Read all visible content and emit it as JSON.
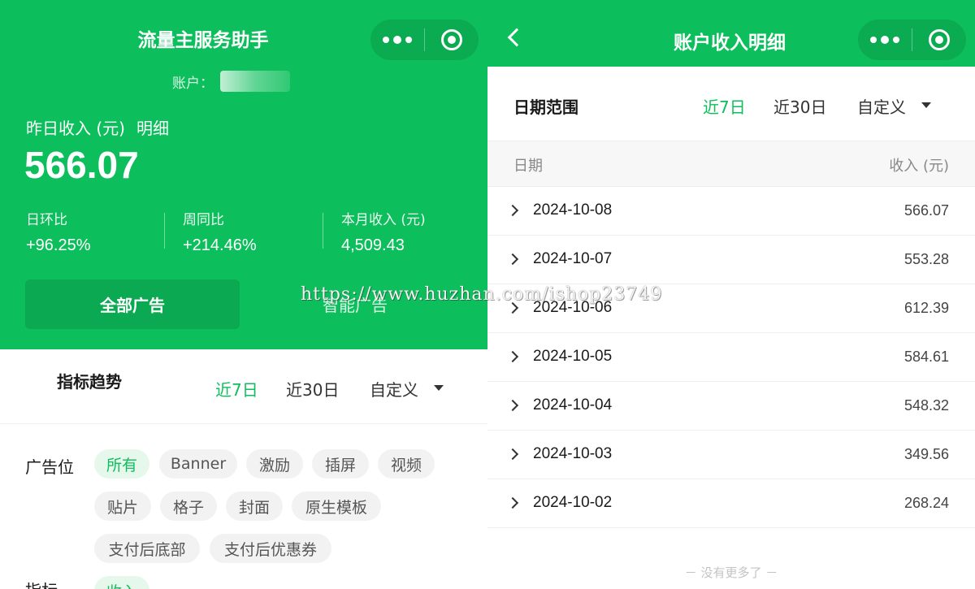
{
  "left": {
    "app_title": "流量主服务助手",
    "account_label": "账户：",
    "yesterday_label": "昨日收入 (元)",
    "detail_link": "明细",
    "yesterday_value": "566.07",
    "stats": [
      {
        "label": "日环比",
        "value": "+96.25%"
      },
      {
        "label": "周同比",
        "value": "+214.46%"
      },
      {
        "label": "本月收入 (元)",
        "value": "4,509.43"
      }
    ],
    "ad_tabs": {
      "all": "全部广告",
      "smart": "智能广告"
    },
    "trend": {
      "title": "指标趋势",
      "ranges": [
        "近7日",
        "近30日",
        "自定义"
      ],
      "active_range": "近7日"
    },
    "ad_position_label": "广告位",
    "ad_positions": [
      "所有",
      "Banner",
      "激励",
      "插屏",
      "视频",
      "贴片",
      "格子",
      "封面",
      "原生模板",
      "支付后底部",
      "支付后优惠券"
    ],
    "active_position": "所有",
    "metric_label": "指标",
    "metric_chip": "收入"
  },
  "right": {
    "title": "账户收入明细",
    "date_range_label": "日期范围",
    "ranges": [
      "近7日",
      "近30日",
      "自定义"
    ],
    "active_range": "近7日",
    "columns": {
      "date": "日期",
      "income": "收入 (元)"
    },
    "rows": [
      {
        "date": "2024-10-08",
        "amount": "566.07"
      },
      {
        "date": "2024-10-07",
        "amount": "553.28"
      },
      {
        "date": "2024-10-06",
        "amount": "612.39"
      },
      {
        "date": "2024-10-05",
        "amount": "584.61"
      },
      {
        "date": "2024-10-04",
        "amount": "548.32"
      },
      {
        "date": "2024-10-03",
        "amount": "349.56"
      },
      {
        "date": "2024-10-02",
        "amount": "268.24"
      }
    ],
    "footer": "－ 没有更多了 －"
  },
  "watermark": "https://www.huzhan.com/ishop23749",
  "colors": {
    "brand_green": "#0dbf5c",
    "chip_bg": "#f2f2f2",
    "active_chip_bg": "#e6f7ec"
  }
}
